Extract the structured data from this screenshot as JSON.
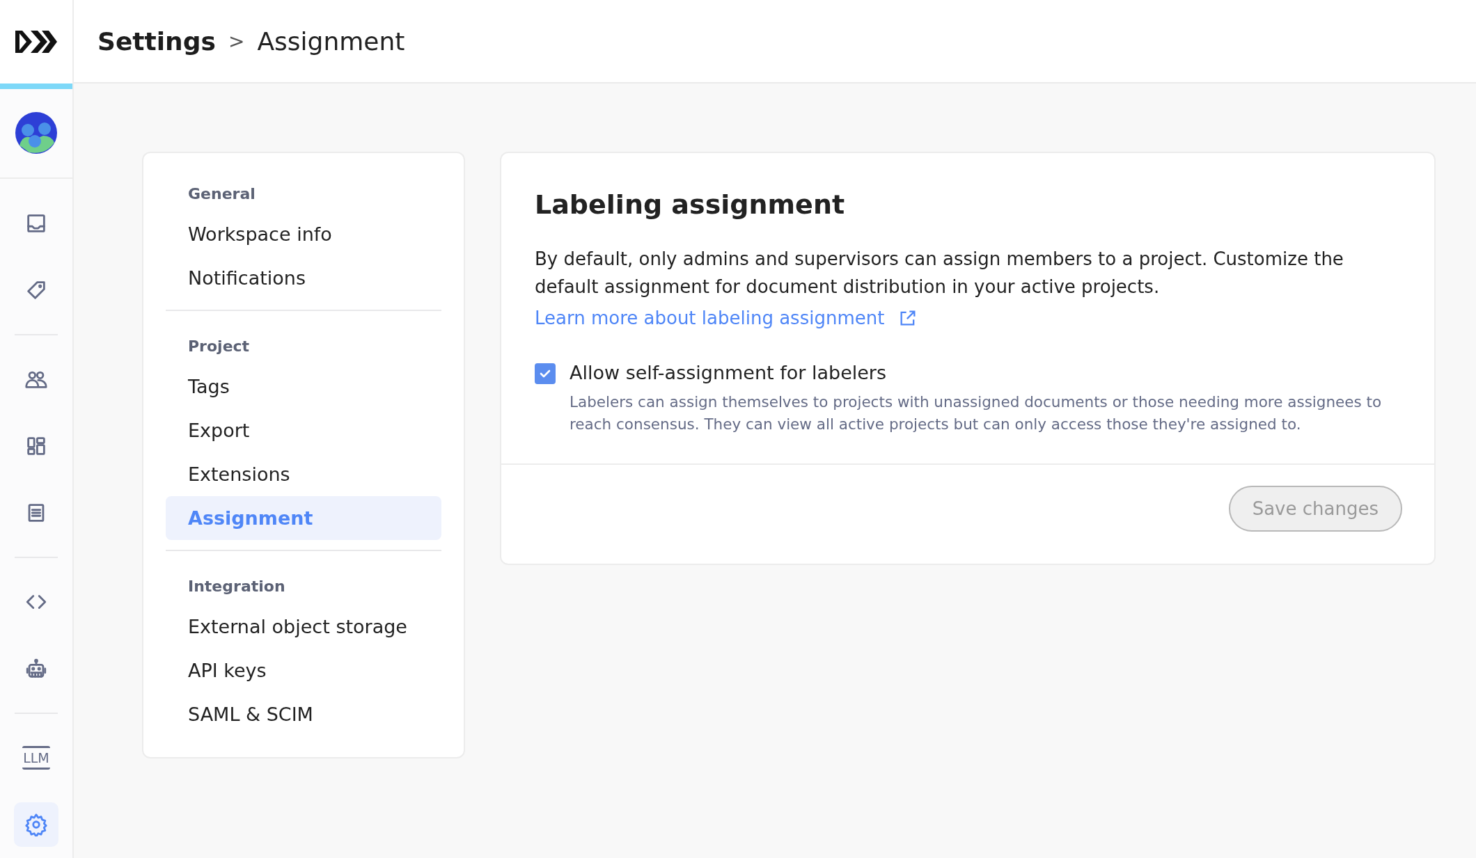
{
  "breadcrumb": {
    "parent": "Settings",
    "separator": ">",
    "current": "Assignment"
  },
  "sidebar": {
    "groups": [
      {
        "items": [
          {
            "selected": false
          },
          {
            "selected": false
          }
        ]
      },
      {
        "items": [
          {
            "selected": false
          },
          {
            "selected": false
          },
          {
            "selected": false
          }
        ]
      },
      {
        "items": [
          {
            "selected": false
          },
          {
            "selected": false
          }
        ]
      },
      {
        "items": [
          {
            "label": "LLM",
            "selected": false
          },
          {
            "selected": true
          }
        ]
      }
    ]
  },
  "settings_nav": {
    "sections": [
      {
        "heading": "General",
        "items": [
          {
            "label": "Workspace info",
            "selected": false
          },
          {
            "label": "Notifications",
            "selected": false
          }
        ]
      },
      {
        "heading": "Project",
        "items": [
          {
            "label": "Tags",
            "selected": false
          },
          {
            "label": "Export",
            "selected": false
          },
          {
            "label": "Extensions",
            "selected": false
          },
          {
            "label": "Assignment",
            "selected": true
          }
        ]
      },
      {
        "heading": "Integration",
        "items": [
          {
            "label": "External object storage",
            "selected": false
          },
          {
            "label": "API keys",
            "selected": false
          },
          {
            "label": "SAML & SCIM",
            "selected": false
          }
        ]
      }
    ]
  },
  "panel": {
    "title": "Labeling assignment",
    "description": "By default, only admins and supervisors can assign members to a project. Customize the default assignment for document distribution in your active projects.",
    "link": "Learn more about labeling assignment",
    "option": {
      "label": "Allow self-assignment for labelers",
      "checked": true,
      "help": "Labelers can assign themselves to projects with unassigned documents or those needing more assignees to reach consensus. They can view all active projects but can only access those they're assigned to."
    },
    "save_button": {
      "label": "Save changes",
      "disabled": true
    }
  }
}
